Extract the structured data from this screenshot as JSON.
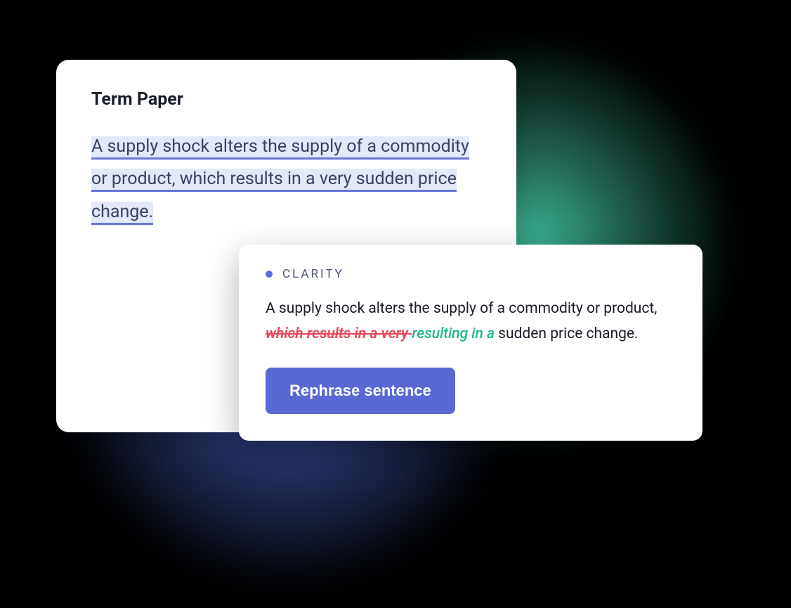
{
  "editor": {
    "title": "Term Paper",
    "highlighted_text": "A supply shock alters the supply of a commodity or product, which results in a very sudden price change."
  },
  "suggestion": {
    "category": "CLARITY",
    "text_before": "A supply shock alters the supply of a commodity or product, ",
    "strike_text": "which results in a very ",
    "replacement_text": " resulting in a ",
    "text_after": "sudden price change.",
    "action_label": "Rephrase sentence"
  }
}
